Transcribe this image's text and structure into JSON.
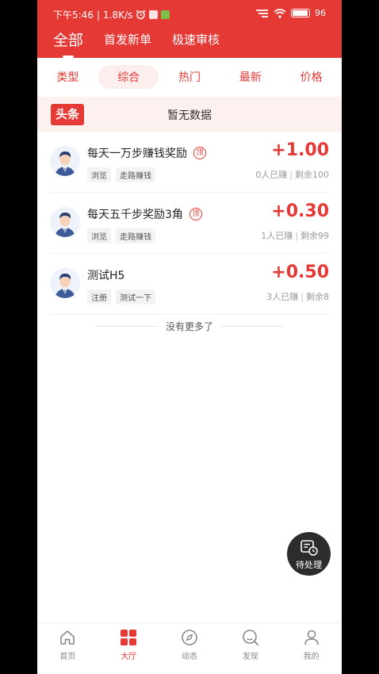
{
  "status_bar": {
    "time": "下午5:46",
    "speed": "1.8K/s",
    "battery": "96"
  },
  "top_tabs": [
    {
      "label": "全部",
      "active": true
    },
    {
      "label": "首发新单",
      "active": false
    },
    {
      "label": "极速审核",
      "active": false
    }
  ],
  "filters": [
    {
      "label": "类型",
      "active": false
    },
    {
      "label": "综合",
      "active": true
    },
    {
      "label": "热门",
      "active": false
    },
    {
      "label": "最新",
      "active": false
    },
    {
      "label": "价格",
      "active": false
    }
  ],
  "headline": {
    "badge": "头条",
    "text": "暂无数据"
  },
  "tasks": [
    {
      "title": "每天一万步赚钱奖励",
      "pinned_badge": "顶",
      "tags": [
        "浏览",
        "走路赚钱"
      ],
      "amount": "+1.00",
      "earned": "0人已赚",
      "remaining": "剩余100"
    },
    {
      "title": "每天五千步奖励3角",
      "pinned_badge": "顶",
      "tags": [
        "浏览",
        "走路赚钱"
      ],
      "amount": "+0.30",
      "earned": "1人已赚",
      "remaining": "剩余99"
    },
    {
      "title": "测试H5",
      "pinned_badge": "",
      "tags": [
        "注册",
        "测试一下"
      ],
      "amount": "+0.50",
      "earned": "3人已赚",
      "remaining": "剩余8"
    }
  ],
  "list_end": "没有更多了",
  "pending_button": "待处理",
  "bottom_nav": [
    {
      "label": "首页",
      "icon": "home-icon",
      "active": false
    },
    {
      "label": "大厅",
      "icon": "grid-icon",
      "active": true
    },
    {
      "label": "动态",
      "icon": "compass-icon",
      "active": false
    },
    {
      "label": "发现",
      "icon": "discover-icon",
      "active": false
    },
    {
      "label": "我的",
      "icon": "user-icon",
      "active": false
    }
  ],
  "colors": {
    "brand": "#e53935",
    "headline_bg": "#fdf1f0",
    "filter_active_bg": "#fdeeee",
    "fab_bg": "#2c2c2c"
  }
}
